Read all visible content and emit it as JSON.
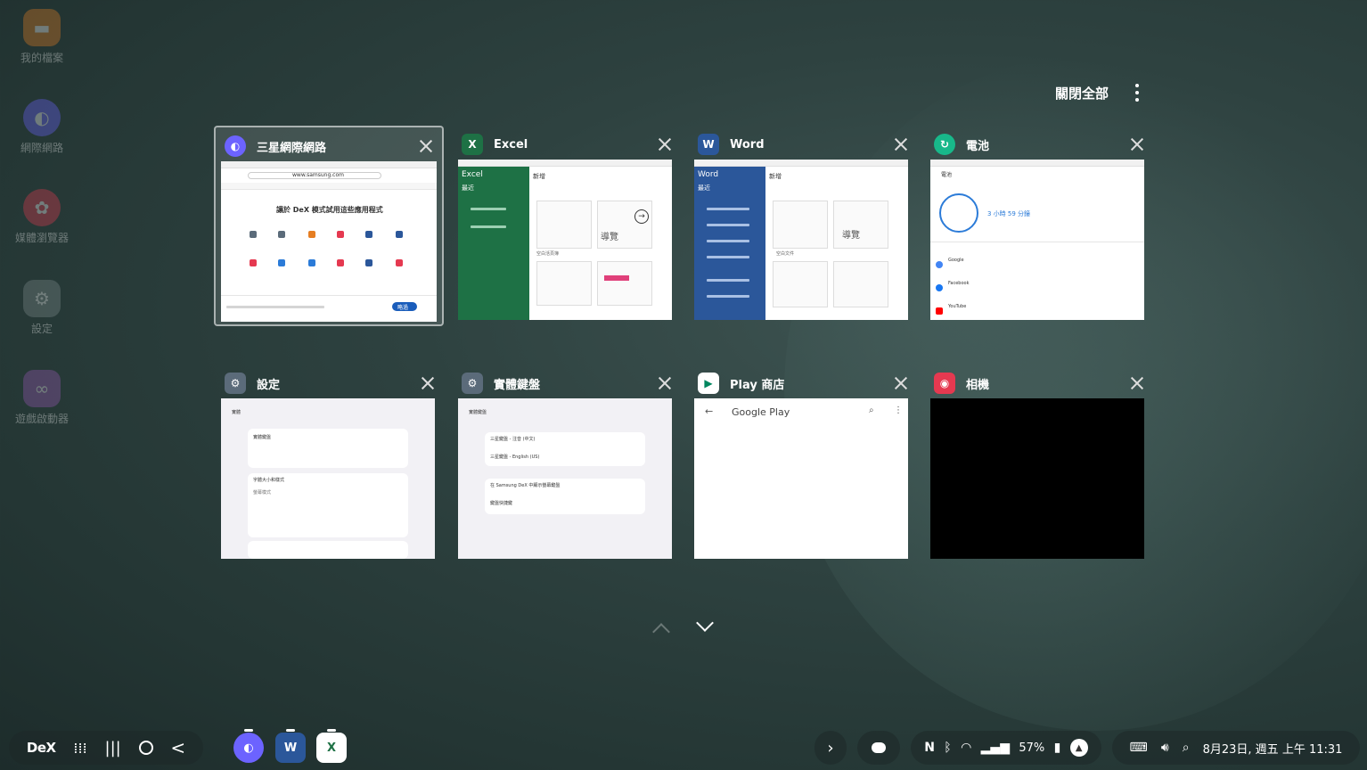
{
  "desktop": {
    "icons": [
      {
        "label": "我的檔案",
        "icon": "folder-icon",
        "color": "#e67e22"
      },
      {
        "label": "網際網路",
        "icon": "internet-icon",
        "color": "#6c63ff"
      },
      {
        "label": "媒體瀏覽器",
        "icon": "media-icon",
        "color": "#e53950"
      },
      {
        "label": "設定",
        "icon": "gear-icon",
        "color": "#7f8c8d"
      },
      {
        "label": "遊戲啟動器",
        "icon": "game-launcher-icon",
        "color": "#9b59b6"
      }
    ]
  },
  "recents": {
    "close_all_label": "關閉全部",
    "cards": [
      {
        "title": "三星網際網路",
        "icon": "samsung-internet-icon",
        "color": "#6c63ff",
        "thumb": {
          "url": "www.samsung.com",
          "heading": "讓於 DeX 模式試用這些應用程式",
          "button": "略過"
        }
      },
      {
        "title": "Excel",
        "icon": "excel-icon",
        "color": "#1e7145",
        "thumb": {
          "app": "Excel",
          "recent": "最近",
          "new": "新增",
          "blank": "空白活頁簿"
        }
      },
      {
        "title": "Word",
        "icon": "word-icon",
        "color": "#2b579a",
        "thumb": {
          "app": "Word",
          "recent": "最近",
          "new": "新增",
          "blank": "空白文件"
        }
      },
      {
        "title": "電池",
        "icon": "battery-icon",
        "color": "#18b88a",
        "thumb": {
          "header": "電池",
          "time": "3 小時 59 分鐘",
          "apps": [
            "Google",
            "Facebook",
            "YouTube"
          ]
        }
      },
      {
        "title": "設定",
        "icon": "settings-icon",
        "color": "#5b6b7a",
        "thumb": {
          "header": "實體",
          "items": [
            "實體鍵盤",
            "字體大小和樣式",
            "螢幕模式"
          ]
        }
      },
      {
        "title": "實體鍵盤",
        "icon": "settings-icon",
        "color": "#5b6b7a",
        "thumb": {
          "header": "實體鍵盤",
          "items": [
            "三星鍵盤 - 注音 (中文)",
            "三星鍵盤 - English (US)",
            "在 Samsung DeX 中顯示螢幕鍵盤",
            "鍵盤快捷鍵"
          ]
        }
      },
      {
        "title": "Play 商店",
        "icon": "play-store-icon",
        "color": "#ffffff",
        "thumb": {
          "header": "Google Play"
        }
      },
      {
        "title": "相機",
        "icon": "camera-icon",
        "color": "#e53950",
        "thumb": {}
      }
    ]
  },
  "taskbar": {
    "dex_label": "DeX",
    "pinned_apps": [
      {
        "name": "samsung-internet",
        "color": "#6c63ff",
        "glyph": "◐"
      },
      {
        "name": "word",
        "color": "#2b579a",
        "glyph": "W"
      },
      {
        "name": "excel",
        "color": "#1e7145",
        "glyph": "X"
      }
    ],
    "battery": "57%",
    "datetime": "8月23日, 週五 上午 11:31"
  }
}
